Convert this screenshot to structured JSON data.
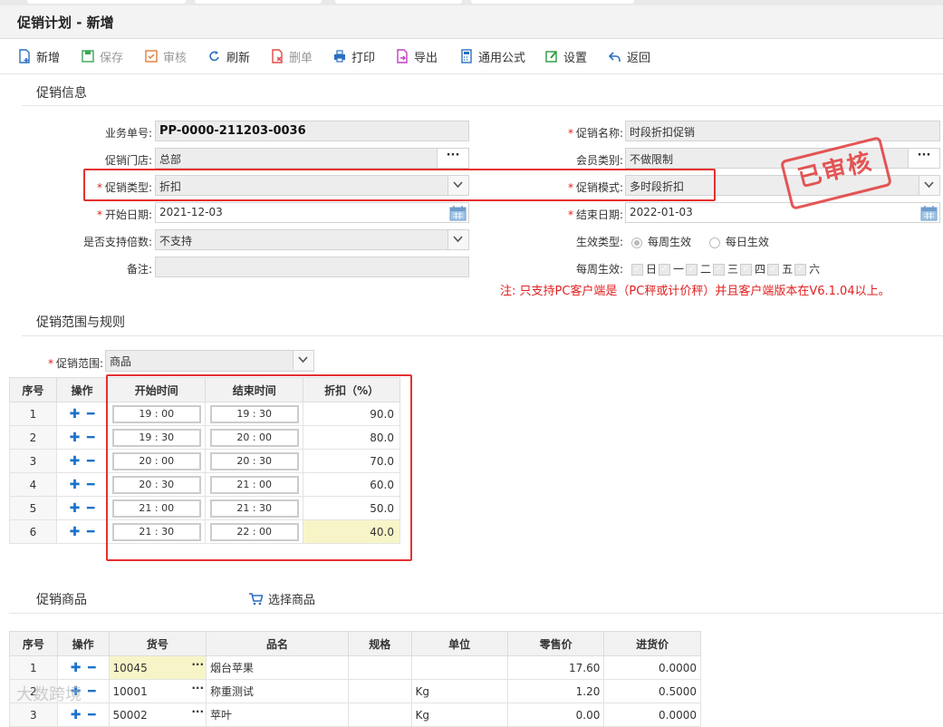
{
  "window": {
    "title": "促销计划 - 新增"
  },
  "toolbar": {
    "new": "新增",
    "save": "保存",
    "audit": "审核",
    "refresh": "刷新",
    "delete": "删单",
    "print": "打印",
    "export": "导出",
    "formula": "通用公式",
    "settings": "设置",
    "back": "返回"
  },
  "promo_info": {
    "section_title": "促销信息",
    "order_no_label": "业务单号:",
    "order_no": "PP-0000-211203-0036",
    "store_label": "促销门店:",
    "store": "总部",
    "type_label": "促销类型:",
    "type": "折扣",
    "start_label": "开始日期:",
    "start_date": "2021-12-03",
    "multiple_label": "是否支持倍数:",
    "multiple": "不支持",
    "remark_label": "备注:",
    "remark": "",
    "name_label": "促销名称:",
    "name": "时段折扣促销",
    "member_label": "会员类别:",
    "member": "不做限制",
    "mode_label": "促销模式:",
    "mode": "多时段折扣",
    "end_label": "结束日期:",
    "end_date": "2022-01-03",
    "effect_label": "生效类型:",
    "effect_weekly": "每周生效",
    "effect_daily": "每日生效",
    "weekday_label": "每周生效:",
    "weekdays": [
      "日",
      "一",
      "二",
      "三",
      "四",
      "五",
      "六"
    ],
    "note": "注: 只支持PC客户端是（PC秤或计价秤）并且客户端版本在V6.1.04以上。",
    "stamp": "已审核"
  },
  "rules": {
    "section_title": "促销范围与规则",
    "scope_label": "促销范围:",
    "scope": "商品",
    "headers": {
      "seq": "序号",
      "op": "操作",
      "start": "开始时间",
      "end": "结束时间",
      "discount": "折扣（%）"
    },
    "rows": [
      {
        "seq": "1",
        "start": "19 : 00",
        "end": "19 : 30",
        "discount": "90.0"
      },
      {
        "seq": "2",
        "start": "19 : 30",
        "end": "20 : 00",
        "discount": "80.0"
      },
      {
        "seq": "3",
        "start": "20 : 00",
        "end": "20 : 30",
        "discount": "70.0"
      },
      {
        "seq": "4",
        "start": "20 : 30",
        "end": "21 : 00",
        "discount": "60.0"
      },
      {
        "seq": "5",
        "start": "21 : 00",
        "end": "21 : 30",
        "discount": "50.0"
      },
      {
        "seq": "6",
        "start": "21 : 30",
        "end": "22 : 00",
        "discount": "40.0"
      }
    ]
  },
  "goods": {
    "section_title": "促销商品",
    "select_label": "选择商品",
    "headers": {
      "seq": "序号",
      "op": "操作",
      "code": "货号",
      "name": "品名",
      "spec": "规格",
      "unit": "单位",
      "retail": "零售价",
      "cost": "进货价"
    },
    "rows": [
      {
        "seq": "1",
        "code": "10045",
        "name": "烟台苹果",
        "spec": "",
        "unit": "",
        "retail": "17.60",
        "cost": "0.0000"
      },
      {
        "seq": "2",
        "code": "10001",
        "name": "称重测试",
        "spec": "",
        "unit": "Kg",
        "retail": "1.20",
        "cost": "0.5000"
      },
      {
        "seq": "3",
        "code": "50002",
        "name": "苹叶",
        "spec": "",
        "unit": "Kg",
        "retail": "0.00",
        "cost": "0.0000"
      }
    ]
  },
  "watermark": "大数跨境",
  "colors": {
    "accent_red": "#e53030",
    "blue_icon": "#1a73c9",
    "highlight_cell": "#f7f5c8"
  }
}
